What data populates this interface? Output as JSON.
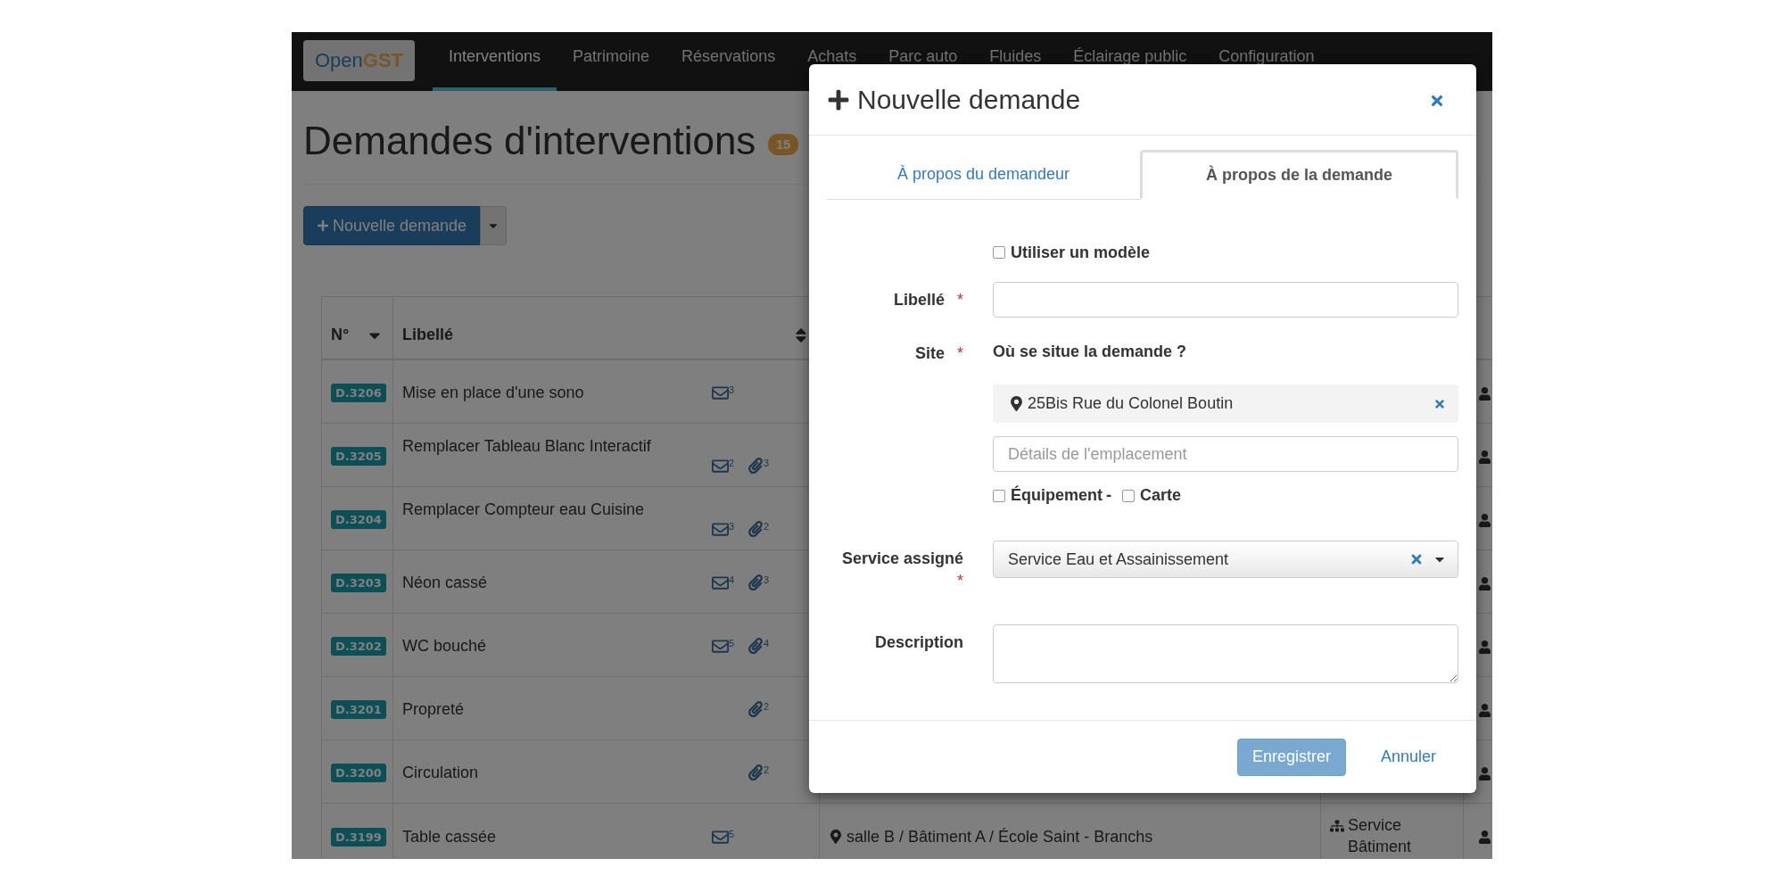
{
  "app": {
    "logo": {
      "part_1": "Open",
      "part_2": "GST"
    },
    "nav": [
      {
        "label": "Interventions",
        "selected": true
      },
      {
        "label": "Patrimoine",
        "selected": false
      },
      {
        "label": "Réservations",
        "selected": false
      },
      {
        "label": "Achats",
        "selected": false
      },
      {
        "label": "Parc auto",
        "selected": false
      },
      {
        "label": "Fluides",
        "selected": false
      },
      {
        "label": "Éclairage public",
        "selected": false
      },
      {
        "label": "Configuration",
        "selected": false
      }
    ]
  },
  "page": {
    "title": "Demandes d'interventions",
    "count": "15",
    "new_button": "Nouvelle demande"
  },
  "table": {
    "columns": [
      {
        "label": "N°",
        "sorted": true
      },
      {
        "label": "Libellé",
        "sorted": false
      }
    ],
    "rows": [
      {
        "id": "D.3206",
        "label": "Mise en place d'une sono",
        "messages": "3"
      },
      {
        "id": "D.3205",
        "label": "Remplacer Tableau Blanc Interactif",
        "messages": "2",
        "attachments": "3"
      },
      {
        "id": "D.3204",
        "label": "Remplacer Compteur eau Cuisine",
        "messages": "3",
        "attachments": "2"
      },
      {
        "id": "D.3203",
        "label": "Néon cassé",
        "messages": "4",
        "attachments": "3"
      },
      {
        "id": "D.3202",
        "label": "WC bouché",
        "messages": "5",
        "attachments": "4"
      },
      {
        "id": "D.3201",
        "label": "Propreté",
        "attachments": "2"
      },
      {
        "id": "D.3200",
        "label": "Circulation",
        "attachments": "2"
      },
      {
        "id": "D.3199",
        "label": "Table cassée",
        "messages": "5",
        "location": "salle B / Bâtiment A / École Saint - Branchs",
        "service": "Service Bâtiment"
      }
    ]
  },
  "modal": {
    "title": "Nouvelle demande",
    "tabs": [
      {
        "label": "À propos du demandeur",
        "selected": false
      },
      {
        "label": "À propos de la demande",
        "selected": true
      }
    ],
    "template_option": {
      "label": "Utiliser un modèle",
      "checked": false
    },
    "fields": [
      {
        "kind": "text",
        "label": "Libellé",
        "required_mark": "*"
      },
      {
        "kind": "site",
        "label": "Site",
        "required_mark": "*",
        "question": "Où se situe la demande ?",
        "selected_site": "25Bis Rue du Colonel Boutin",
        "details": {
          "placeholder": "Détails de l'emplacement"
        },
        "options": [
          {
            "label": "Équipement",
            "checked": false
          },
          {
            "label": "Carte",
            "checked": false
          }
        ],
        "separator": "-"
      },
      {
        "kind": "select",
        "label": "Service assigné",
        "required_mark": "*",
        "value": "Service Eau et Assainissement"
      },
      {
        "kind": "textarea",
        "label": "Description"
      }
    ],
    "buttons": [
      {
        "label": "Enregistrer",
        "kind": "primary",
        "disabled": true
      },
      {
        "label": "Annuler",
        "kind": "link",
        "disabled": false
      }
    ]
  }
}
